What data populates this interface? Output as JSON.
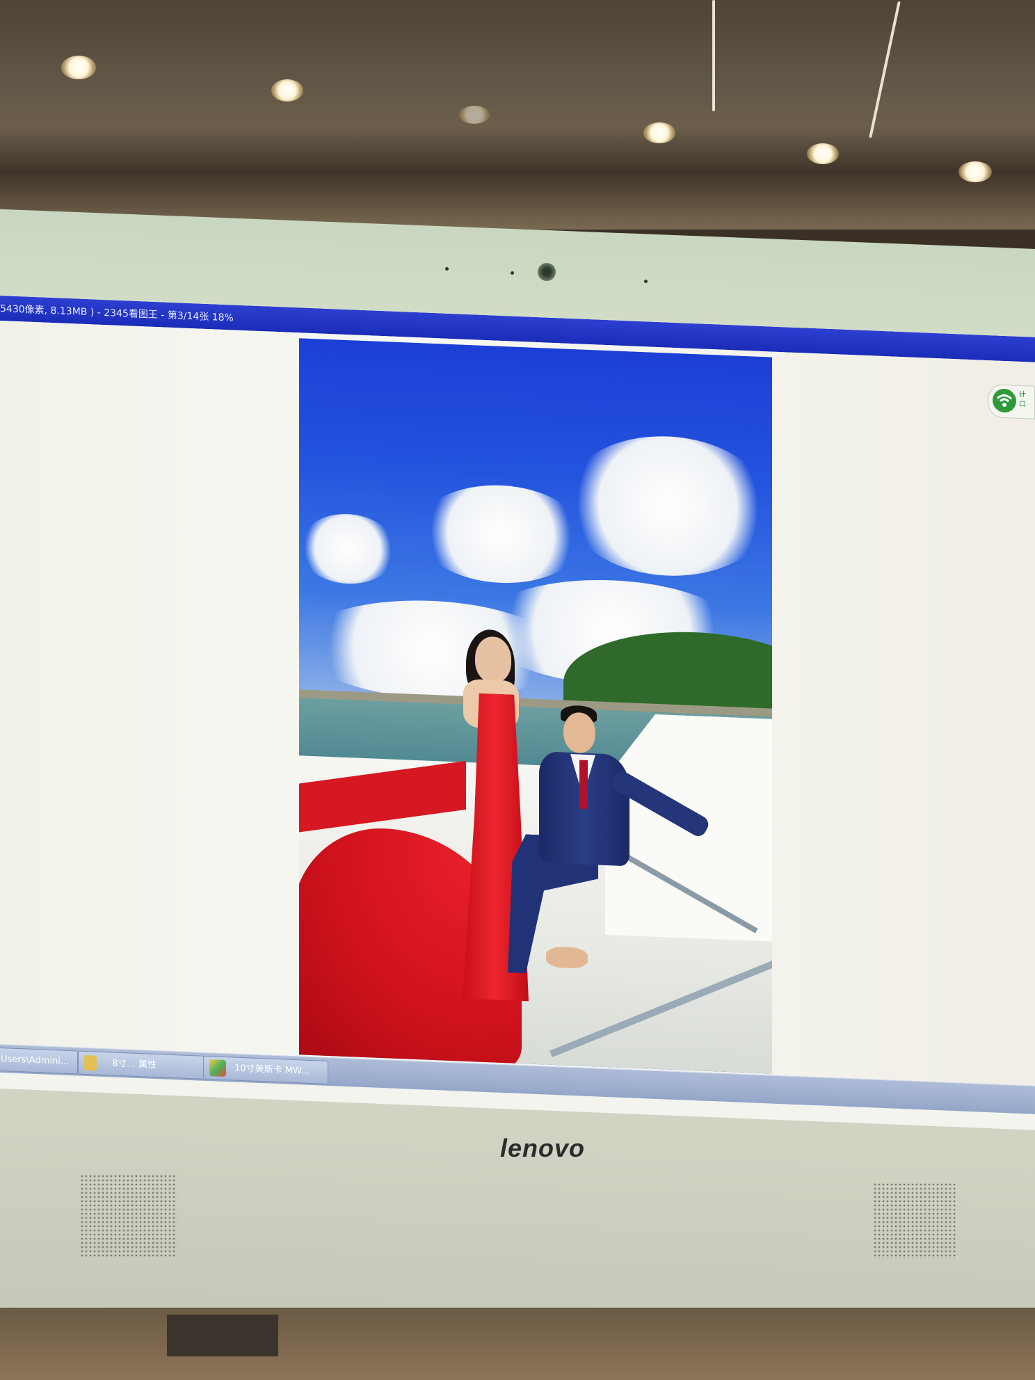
{
  "window": {
    "title": "5430像素, 8.13MB ) - 2345看图王 - 第3/14张 18%"
  },
  "taskbar": {
    "items": [
      {
        "label": "Users\\Admini..."
      },
      {
        "label": "8寸...  属性"
      },
      {
        "label": "10寸美斯卡 MW..."
      }
    ]
  },
  "wifi_widget": {
    "text": "计\n口"
  },
  "monitor": {
    "brand": "lenovo"
  },
  "colors": {
    "title_bar": "#1a2cb8",
    "taskbar": "#a2b2d0",
    "dress": "#d6141e",
    "suit": "#223276",
    "sky": "#2454de"
  },
  "icons": [
    "webcam-icon",
    "wifi-icon",
    "folder-icon",
    "image-viewer-icon"
  ]
}
